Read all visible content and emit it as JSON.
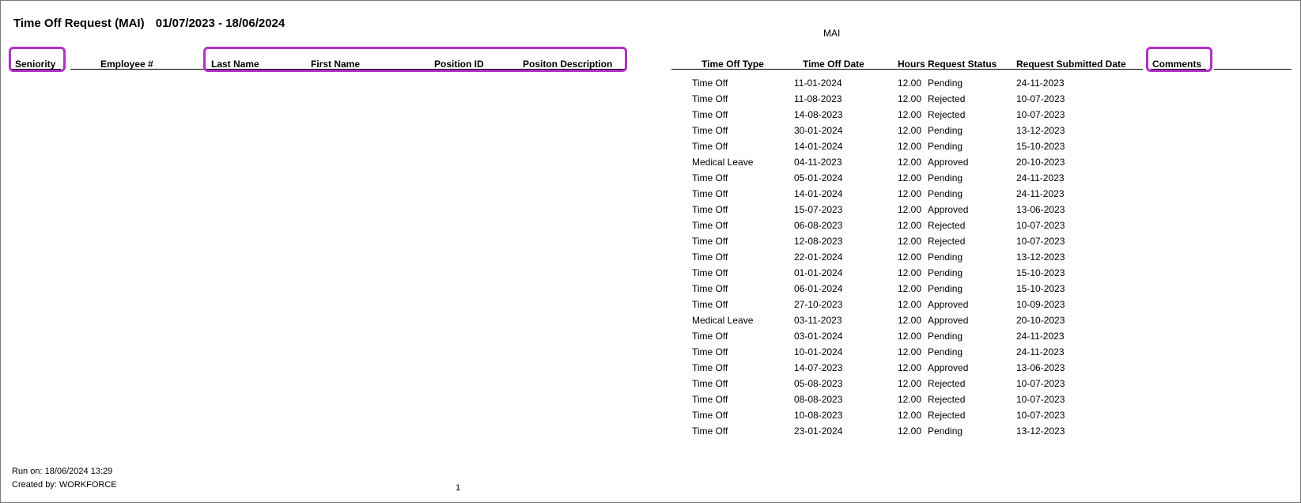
{
  "report": {
    "title": "Time Off Request (MAI)",
    "date_range": "01/07/2023 - 18/06/2024",
    "group_label": "MAI"
  },
  "columns": {
    "seniority": "Seniority",
    "employee_num": "Employee #",
    "last_name": "Last Name",
    "first_name": "First Name",
    "position_id": "Position ID",
    "position_desc": "Positon Description",
    "time_off_type": "Time Off Type",
    "time_off_date": "Time Off Date",
    "hours": "Hours",
    "request_status": "Request Status",
    "request_submitted": "Request Submitted Date",
    "comments": "Comments"
  },
  "rows": [
    {
      "type": "Time Off",
      "date": "11-01-2024",
      "hours": "12.00",
      "status": "Pending",
      "submitted": "24-11-2023"
    },
    {
      "type": "Time Off",
      "date": "11-08-2023",
      "hours": "12.00",
      "status": "Rejected",
      "submitted": "10-07-2023"
    },
    {
      "type": "Time Off",
      "date": "14-08-2023",
      "hours": "12.00",
      "status": "Rejected",
      "submitted": "10-07-2023"
    },
    {
      "type": "Time Off",
      "date": "30-01-2024",
      "hours": "12.00",
      "status": "Pending",
      "submitted": "13-12-2023"
    },
    {
      "type": "Time Off",
      "date": "14-01-2024",
      "hours": "12.00",
      "status": "Pending",
      "submitted": "15-10-2023"
    },
    {
      "type": "Medical Leave",
      "date": "04-11-2023",
      "hours": "12.00",
      "status": "Approved",
      "submitted": "20-10-2023"
    },
    {
      "type": "Time Off",
      "date": "05-01-2024",
      "hours": "12.00",
      "status": "Pending",
      "submitted": "24-11-2023"
    },
    {
      "type": "Time Off",
      "date": "14-01-2024",
      "hours": "12.00",
      "status": "Pending",
      "submitted": "24-11-2023"
    },
    {
      "type": "Time Off",
      "date": "15-07-2023",
      "hours": "12.00",
      "status": "Approved",
      "submitted": "13-06-2023"
    },
    {
      "type": "Time Off",
      "date": "06-08-2023",
      "hours": "12.00",
      "status": "Rejected",
      "submitted": "10-07-2023"
    },
    {
      "type": "Time Off",
      "date": "12-08-2023",
      "hours": "12.00",
      "status": "Rejected",
      "submitted": "10-07-2023"
    },
    {
      "type": "Time Off",
      "date": "22-01-2024",
      "hours": "12.00",
      "status": "Pending",
      "submitted": "13-12-2023"
    },
    {
      "type": "Time Off",
      "date": "01-01-2024",
      "hours": "12.00",
      "status": "Pending",
      "submitted": "15-10-2023"
    },
    {
      "type": "Time Off",
      "date": "06-01-2024",
      "hours": "12.00",
      "status": "Pending",
      "submitted": "15-10-2023"
    },
    {
      "type": "Time Off",
      "date": "27-10-2023",
      "hours": "12.00",
      "status": "Approved",
      "submitted": "10-09-2023"
    },
    {
      "type": "Medical Leave",
      "date": "03-11-2023",
      "hours": "12.00",
      "status": "Approved",
      "submitted": "20-10-2023"
    },
    {
      "type": "Time Off",
      "date": "03-01-2024",
      "hours": "12.00",
      "status": "Pending",
      "submitted": "24-11-2023"
    },
    {
      "type": "Time Off",
      "date": "10-01-2024",
      "hours": "12.00",
      "status": "Pending",
      "submitted": "24-11-2023"
    },
    {
      "type": "Time Off",
      "date": "14-07-2023",
      "hours": "12.00",
      "status": "Approved",
      "submitted": "13-06-2023"
    },
    {
      "type": "Time Off",
      "date": "05-08-2023",
      "hours": "12.00",
      "status": "Rejected",
      "submitted": "10-07-2023"
    },
    {
      "type": "Time Off",
      "date": "08-08-2023",
      "hours": "12.00",
      "status": "Rejected",
      "submitted": "10-07-2023"
    },
    {
      "type": "Time Off",
      "date": "10-08-2023",
      "hours": "12.00",
      "status": "Rejected",
      "submitted": "10-07-2023"
    },
    {
      "type": "Time Off",
      "date": "23-01-2024",
      "hours": "12.00",
      "status": "Pending",
      "submitted": "13-12-2023"
    }
  ],
  "footer": {
    "run_on": "Run on: 18/06/2024 13:29",
    "created_by": "Created by: WORKFORCE",
    "page_number": "1"
  }
}
